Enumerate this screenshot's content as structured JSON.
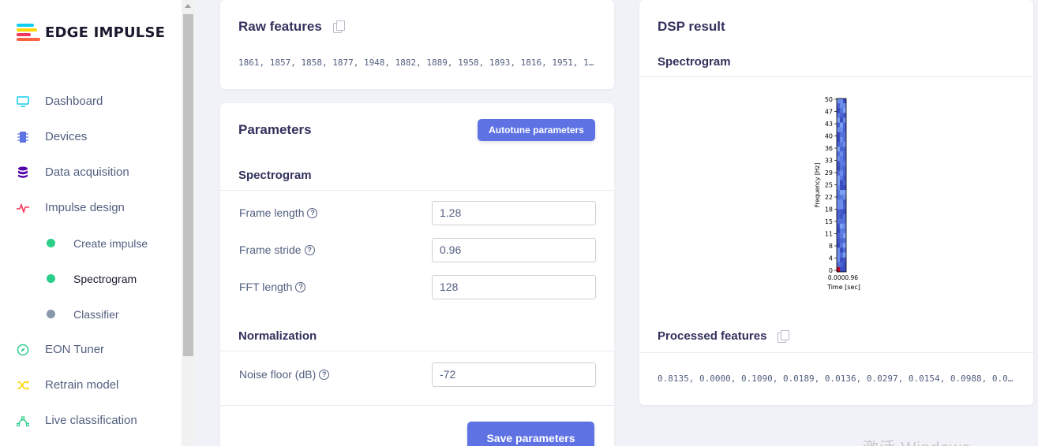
{
  "brand": {
    "name": "EDGE IMPULSE"
  },
  "sidebar": {
    "items": [
      {
        "label": "Dashboard",
        "icon": "monitor-icon",
        "color": "#11cdef"
      },
      {
        "label": "Devices",
        "icon": "chip-icon",
        "color": "#5e72e4"
      },
      {
        "label": "Data acquisition",
        "icon": "database-icon",
        "color": "#5603ad"
      },
      {
        "label": "Impulse design",
        "icon": "pulse-icon",
        "color": "#f5365c"
      }
    ],
    "subitems": [
      {
        "label": "Create impulse",
        "status": "complete",
        "color": "#2dce89"
      },
      {
        "label": "Spectrogram",
        "status": "complete",
        "color": "#2dce89"
      },
      {
        "label": "Classifier",
        "status": "pending",
        "color": "#8898aa"
      }
    ],
    "items_after": [
      {
        "label": "EON Tuner",
        "icon": "compass-icon",
        "color": "#2dce89"
      },
      {
        "label": "Retrain model",
        "icon": "shuffle-icon",
        "color": "#ffd600"
      },
      {
        "label": "Live classification",
        "icon": "vector-icon",
        "color": "#2dce89"
      }
    ]
  },
  "raw_features": {
    "title": "Raw features",
    "values": "1861, 1857, 1858, 1877, 1948, 1882, 1889, 1958, 1893, 1816, 1951, 1…"
  },
  "parameters": {
    "title": "Parameters",
    "autotune_label": "Autotune parameters",
    "spectrogram_section": "Spectrogram",
    "frame_length_label": "Frame length",
    "frame_length_value": "1.28",
    "frame_stride_label": "Frame stride",
    "frame_stride_value": "0.96",
    "fft_length_label": "FFT length",
    "fft_length_value": "128",
    "normalization_section": "Normalization",
    "noise_floor_label": "Noise floor (dB)",
    "noise_floor_value": "-72",
    "save_label": "Save parameters"
  },
  "dsp": {
    "title": "DSP result",
    "spectrogram_title": "Spectrogram",
    "processed_title": "Processed features",
    "processed_values": "0.8135, 0.0000, 0.1090, 0.0189, 0.0136, 0.0297, 0.0154, 0.0988, 0.0…"
  },
  "plot": {
    "ylabel": "Frequency [Hz]",
    "xlabel": "Time [sec]",
    "yticks": [
      "50",
      "47",
      "43",
      "40",
      "36",
      "33",
      "29",
      "25",
      "22",
      "18",
      "15",
      "11",
      "8",
      "4",
      "0"
    ],
    "xticks_overlapped": "0.0000.96",
    "colormap": "coolwarm"
  },
  "watermark": "激活 Windows"
}
